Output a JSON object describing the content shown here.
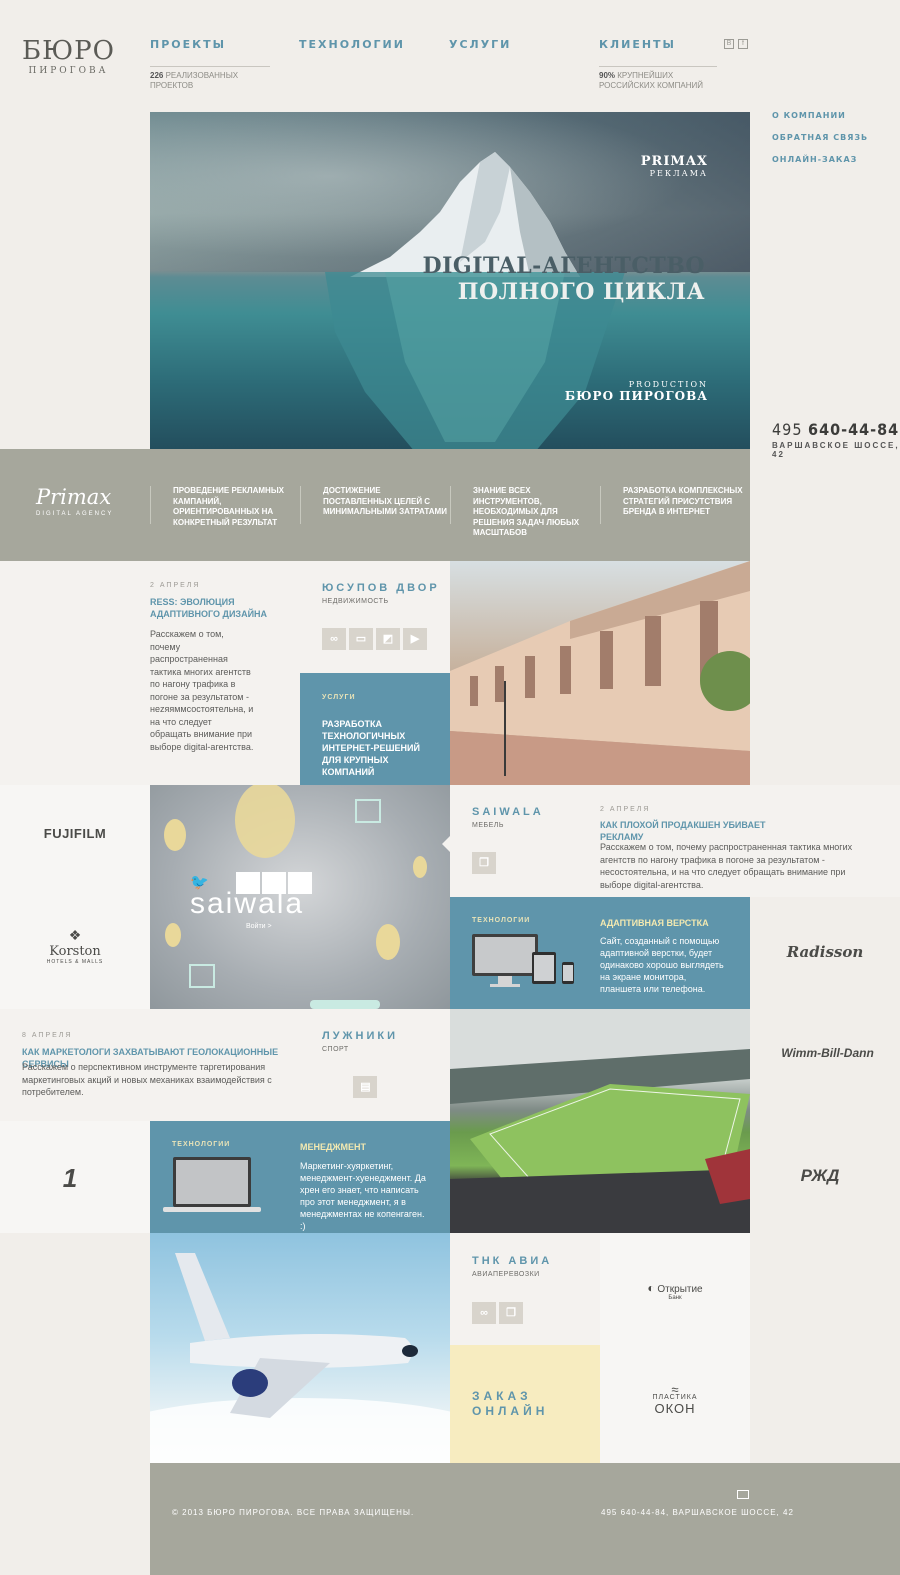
{
  "logo": {
    "main": "БЮРО",
    "sub": "ПИРОГОВА"
  },
  "nav": [
    {
      "label": "ПРОЕКТЫ",
      "note_count": "226",
      "note_text": "РЕАЛИЗОВАННЫХ ПРОЕКТОВ"
    },
    {
      "label": "ТЕХНОЛОГИИ"
    },
    {
      "label": "УСЛУГИ"
    },
    {
      "label": "КЛИЕНТЫ",
      "note_count": "90%",
      "note_text": "КРУПНЕЙШИХ РОССИЙСКИХ КОМПАНИЙ"
    }
  ],
  "social": {
    "vk": "В",
    "fb": "f"
  },
  "side_links": [
    "О КОМПАНИИ",
    "ОБРАТНАЯ СВЯЗЬ",
    "ОНЛАЙН-ЗАКАЗ"
  ],
  "contact": {
    "phone_code": "495",
    "phone_number": "640-44-84",
    "address": "ВАРШАВСКОЕ ШОССЕ, 42"
  },
  "hero": {
    "client": "PRIMAX",
    "client_sub": "РЕКЛАМА",
    "headline_1": "DIGITAL-АГЕНТСТВО",
    "headline_2": "ПОЛНОГО ЦИКЛА",
    "prod_label": "PRODUCTION",
    "prod_name": "БЮРО ПИРОГОВА"
  },
  "primax": {
    "logo": "Primax",
    "logo_sub": "DIGITAL AGENCY",
    "items": [
      "ПРОВЕДЕНИЕ РЕКЛАМНЫХ КАМПАНИЙ, ОРИЕНТИРОВАННЫХ НА КОНКРЕТНЫЙ РЕЗУЛЬТАТ",
      "ДОСТИЖЕНИЕ ПОСТАВЛЕННЫХ ЦЕЛЕЙ С МИНИМАЛЬНЫМИ ЗАТРАТАМИ",
      "ЗНАНИЕ ВСЕХ ИНСТРУМЕНТОВ, НЕОБХОДИМЫХ ДЛЯ РЕШЕНИЯ ЗАДАЧ ЛЮБЫХ МАСШТАБОВ",
      "РАЗРАБОТКА КОМПЛЕКСНЫХ СТРАТЕГИЙ ПРИСУТСТВИЯ БРЕНДА В ИНТЕРНЕТ"
    ]
  },
  "news1": {
    "date": "2 АПРЕЛЯ",
    "title": "RESS: ЭВОЛЮЦИЯ АДАПТИВНОГО ДИЗАЙНА",
    "text": "Расскажем о том, почему распространенная тактика многих агентств по нагону трафика в погоне за результатом - неzяяммсостоятельна, и на что следует обращать внимание при выборе digital-агентства."
  },
  "proj_yusupov": {
    "title": "ЮСУПОВ ДВОР",
    "sub": "НЕДВИЖИМОСТЬ"
  },
  "service": {
    "label": "УСЛУГИ",
    "text": "РАЗРАБОТКА ТЕХНОЛОГИЧНЫХ ИНТЕРНЕТ-РЕШЕНИЙ ДЛЯ КРУПНЫХ КОМПАНИЙ"
  },
  "brands": {
    "fujifilm": "FUJIFILM",
    "korston": "Korston",
    "korston_sub": "HOTELS & MALLS",
    "radisson": "Radisson",
    "wimm": "Wimm-Bill-Dann",
    "perviy": "1",
    "rzd": "РЖД",
    "otkritie": "Открытие",
    "otkritie_sub": "Банк",
    "plastika": "ПЛАСТИКА",
    "plastika_2": "ОКОН"
  },
  "saiwala_promo": {
    "logo": "saiwala",
    "enter": "Войти >"
  },
  "proj_saiwala": {
    "title": "SAIWALA",
    "sub": "МЕБЕЛЬ"
  },
  "news2": {
    "date": "2 АПРЕЛЯ",
    "title": "КАК ПЛОХОЙ ПРОДАКШЕН УБИВАЕТ РЕКЛАМУ",
    "text": "Расскажем о том, почему распространенная тактика многих агентств по нагону трафика в погоне за результатом - несостоятельна, и на что следует обращать внимание при выборе digital-агентства."
  },
  "tech1": {
    "label": "ТЕХНОЛОГИИ",
    "title": "АДАПТИВНАЯ ВЕРСТКА",
    "text": "Сайт, созданный с помощью адаптивной верстки, будет одинаково хорошо выглядеть на экране монитора, планшета или телефона."
  },
  "news3": {
    "date": "8 АПРЕЛЯ",
    "title": "КАК МАРКЕТОЛОГИ ЗАХВАТЫВАЮТ ГЕОЛОКАЦИОННЫЕ СЕРВИСЫ",
    "text": "Расскажем о перспективном инструменте таргетирования маркетинговых акций и новых механиках взаимодействия с потребителем."
  },
  "proj_luzhniki": {
    "title": "ЛУЖНИКИ",
    "sub": "СПОРТ"
  },
  "tech2": {
    "label": "ТЕХНОЛОГИИ",
    "title": "МЕНЕДЖМЕНТ",
    "text": "Маркетинг-хуяркетинг, менеджмент-хуенеджмент. Да хрен его знает, что написать про этот менеджмент, я в менеджментах не копенгаген. :)"
  },
  "proj_tnk": {
    "title": "ТНК АВИА",
    "sub": "АВИАПЕРЕВОЗКИ"
  },
  "order": {
    "line1": "ЗАКАЗ",
    "line2": "ОНЛАЙН"
  },
  "footer": {
    "copyright": "© 2013 БЮРО ПИРОГОВА. ВСЕ ПРАВА ЗАЩИЩЕНЫ.",
    "contact": "495 640-44-84, ВАРШАВСКОЕ ШОССЕ, 42"
  },
  "colors": {
    "accent": "#5f95ab",
    "band": "#a6a79c",
    "background": "#f1eeea",
    "order_bg": "#f7ecc0"
  }
}
